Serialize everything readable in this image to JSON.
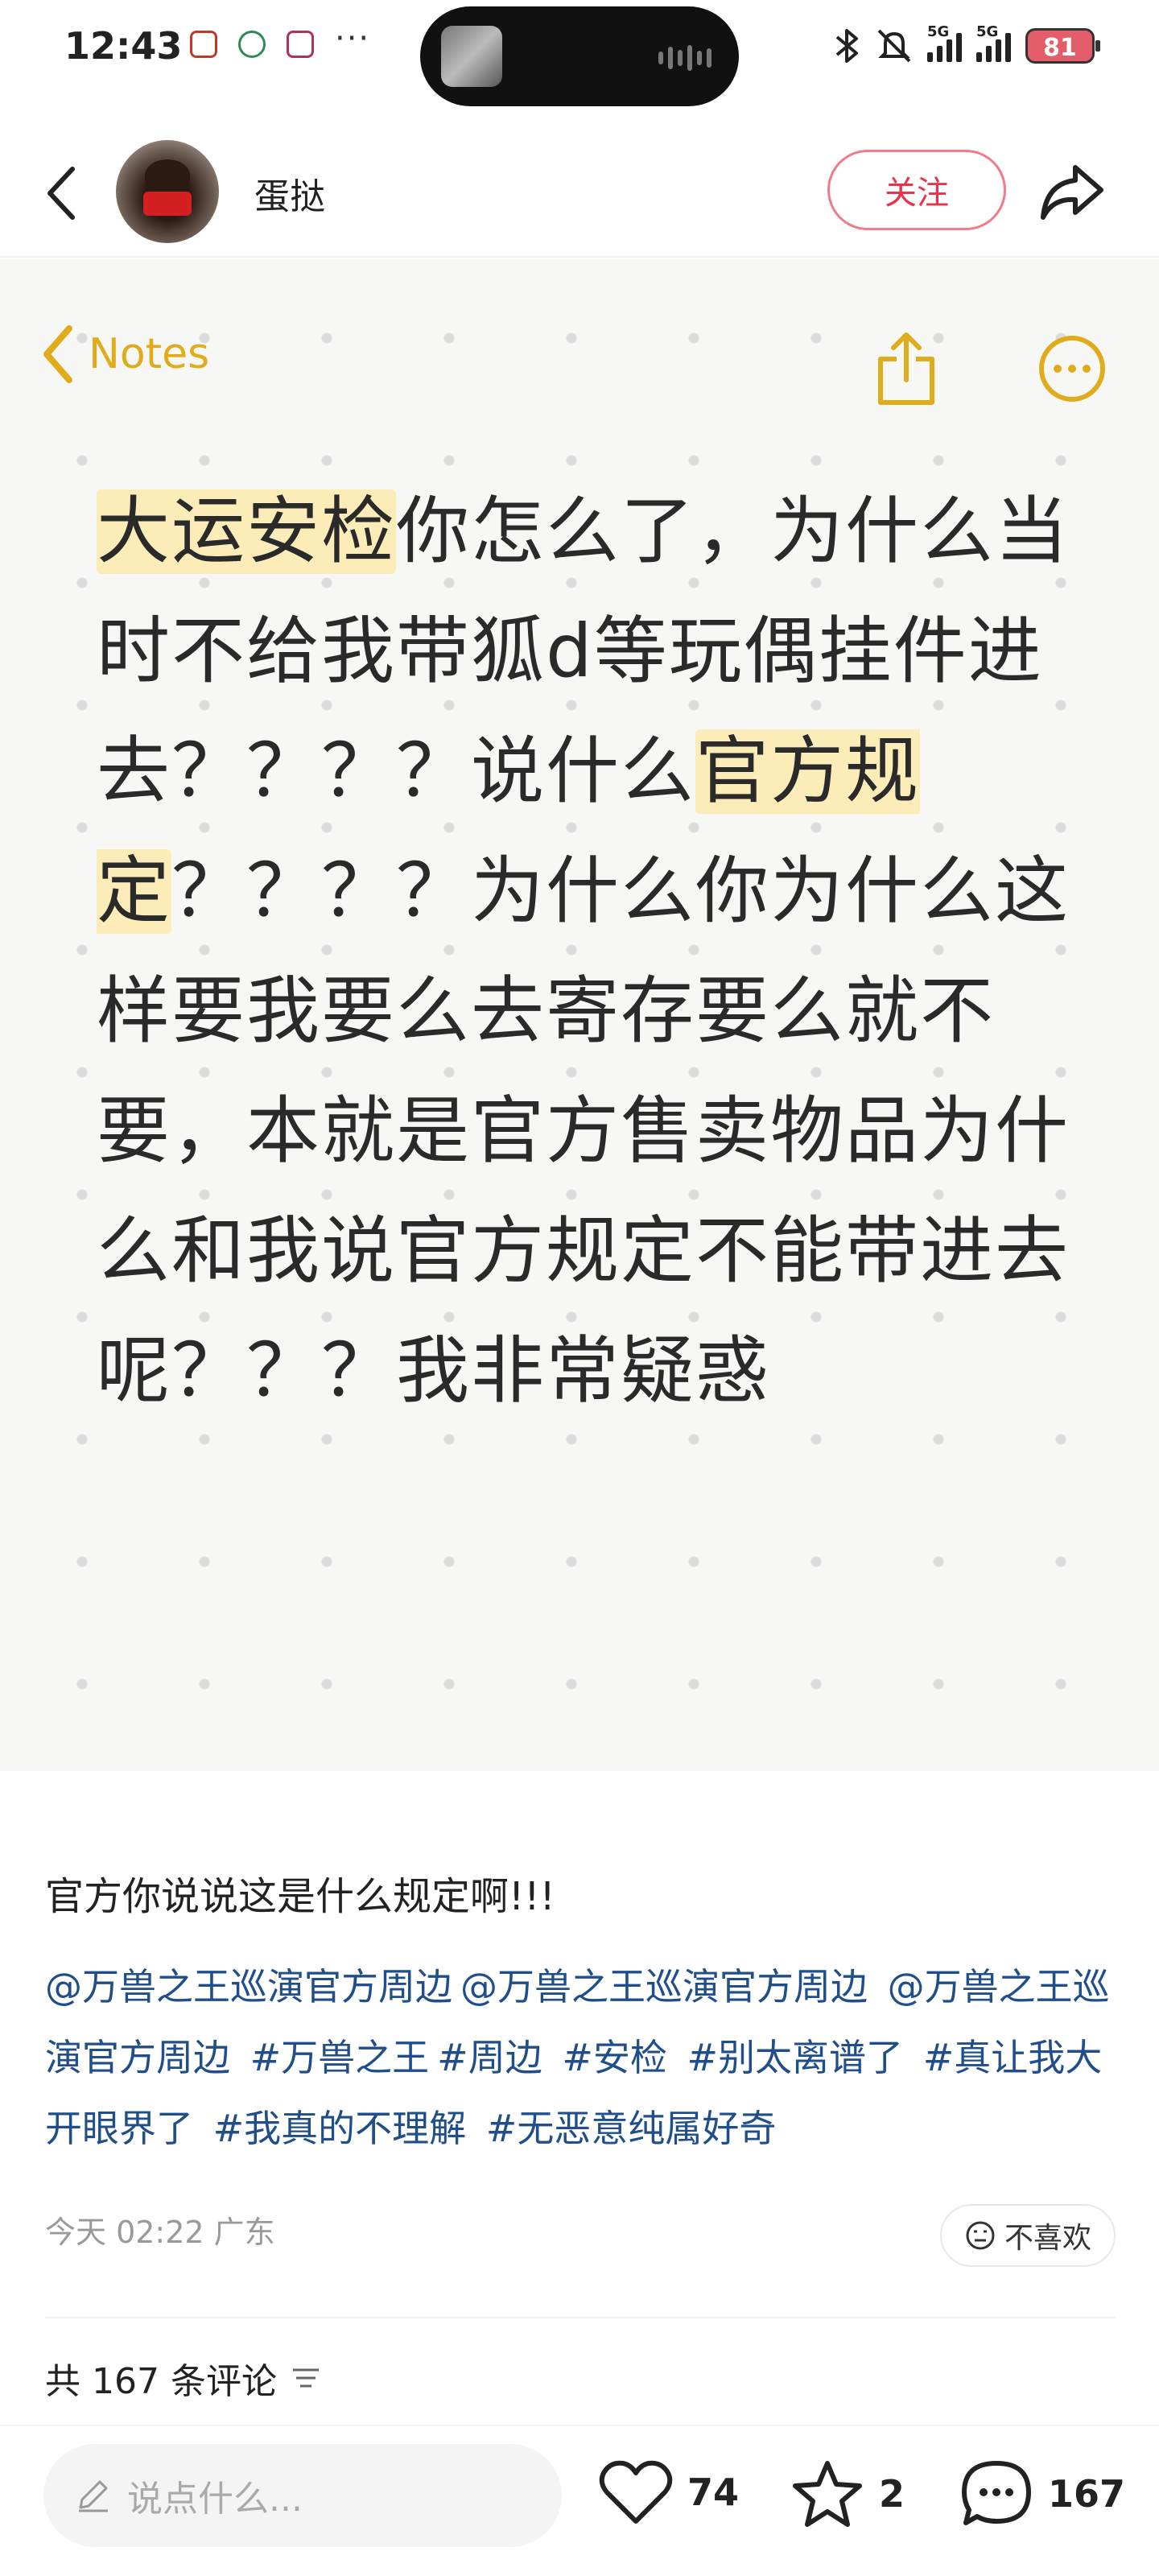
{
  "status_bar": {
    "time": "12:43",
    "more": "···",
    "network1": "5G",
    "network2": "5G",
    "battery": "81"
  },
  "header": {
    "username": "蛋挞",
    "follow_label": "关注"
  },
  "note_image": {
    "app_label": "Notes",
    "text_hl1": "大运安检",
    "text_part1": "你怎么了，为什么当时不给我带狐d等玩偶挂件进去？？？？说什么",
    "text_hl2": "官方规定",
    "text_part2": "？？？？为什么你为什么这样要我要么去寄存要么就不要，本就是官方售卖物品为什么和我说官方规定不能带进去呢？？？我非常疑惑"
  },
  "post": {
    "title": "官方你说说这是什么规定啊!!!",
    "tags": [
      "@万兽之王巡演官方周边",
      "@万兽之王巡演官方周边",
      "@万兽之王巡演官方周边",
      "#万兽之王",
      "#周边",
      "#安检",
      "#别太离谱了",
      "#真让我大开眼界了",
      "#我真的不理解",
      "#无恶意纯属好奇"
    ],
    "time_location": "今天 02:22 广东",
    "dislike_label": "不喜欢",
    "comment_count_label": "共 167 条评论"
  },
  "bottom_bar": {
    "input_placeholder": "说点什么...",
    "likes": "74",
    "favorites": "2",
    "comments": "167"
  },
  "colors": {
    "accent_red": "#e8334a",
    "notes_yellow": "#e0ac1c",
    "highlight": "#fbecb8",
    "tag_blue": "#1f4e8a"
  }
}
